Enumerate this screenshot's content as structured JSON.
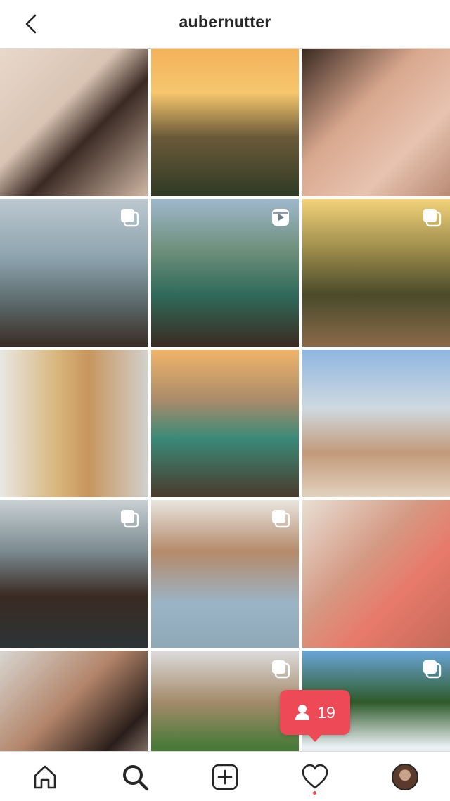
{
  "header": {
    "username": "aubernutter",
    "back_icon": "chevron-left-icon"
  },
  "grid": {
    "posts": [
      {
        "bg": "linear-gradient(135deg,#e8d9cc 0%,#d9c3b2 40%,#3a2a24 60%,#cfb6a3 100%)",
        "multi": false
      },
      {
        "bg": "linear-gradient(180deg,#f3b25b 0%,#f7c66d 30%,#6b5a3a 60%,#2f3a24 100%)",
        "multi": false
      },
      {
        "bg": "linear-gradient(135deg,#3b2a22 0%,#d9a88e 40%,#e7c3b0 70%,#b98b74 100%)",
        "multi": false
      },
      {
        "bg": "linear-gradient(180deg,#bcc8d0 0%,#8ca3ae 40%,#5c6a6c 70%,#3a2c24 100%)",
        "multi": true
      },
      {
        "bg": "linear-gradient(180deg,#9fb8cc 0%,#6d8f7a 35%,#2f6a5a 65%,#3a2a20 100%)",
        "multi": true,
        "video": true
      },
      {
        "bg": "linear-gradient(180deg,#f3d27a 0%,#9a8a4a 35%,#4a4a2a 65%,#8a6a4a 100%)",
        "multi": true
      },
      {
        "bg": "linear-gradient(90deg,#e8e8e4 0%,#d8b47a 40%,#c8955e 60%,#d2d0cc 100%)",
        "multi": false
      },
      {
        "bg": "linear-gradient(180deg,#f1b56a 0%,#a88a6a 35%,#3a8a78 60%,#4a3a2c 100%)",
        "multi": false
      },
      {
        "bg": "linear-gradient(180deg,#8fb6e0 0%,#cfd9e0 40%,#c29a7a 70%,#e3d2bf 100%)",
        "multi": false
      },
      {
        "bg": "linear-gradient(180deg,#c9d0d3 0%,#7a8a90 35%,#3a2a22 65%,#2c3436 100%)",
        "multi": true
      },
      {
        "bg": "linear-gradient(180deg,#e9e6e0 0%,#b58a6a 35%,#9bb4c6 70%,#8fa8b8 100%)",
        "multi": true
      },
      {
        "bg": "linear-gradient(135deg,#e9dfd4 0%,#d49a84 40%,#e87a6a 65%,#c46a5a 100%)",
        "multi": false
      },
      {
        "bg": "linear-gradient(135deg,#d8d6d2 0%,#b3856a 40%,#2a1e1a 70%,#d9c4b2 100%)",
        "multi": false
      },
      {
        "bg": "linear-gradient(180deg,#dcdcdc 0%,#a48a6a 35%,#4a7a3a 65%,#5a6a2a 100%)",
        "multi": true
      },
      {
        "bg": "linear-gradient(180deg,#6aa6d8 0%,#2f5a2a 35%,#e8eef2 65%,#f1f3f4 100%)",
        "multi": true
      }
    ]
  },
  "notification": {
    "icon": "person-icon",
    "count": "19"
  },
  "tabs": [
    {
      "name": "home",
      "icon": "home-icon"
    },
    {
      "name": "search",
      "icon": "search-icon"
    },
    {
      "name": "new-post",
      "icon": "plus-square-icon"
    },
    {
      "name": "activity",
      "icon": "heart-icon"
    },
    {
      "name": "profile",
      "icon": "avatar"
    }
  ],
  "colors": {
    "accent": "#ed4956",
    "text": "#262626",
    "divider": "#dbdbdb"
  }
}
